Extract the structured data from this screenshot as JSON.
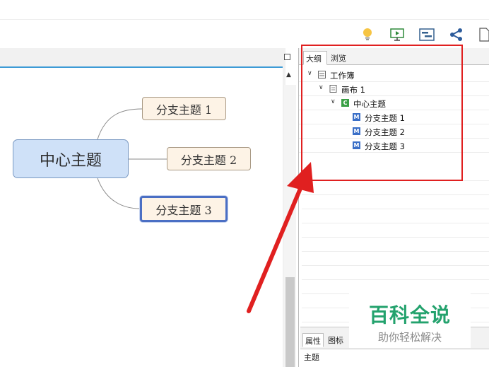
{
  "mindmap": {
    "central": "中心主题",
    "branches": [
      "分支主题 1",
      "分支主题 2",
      "分支主题 3"
    ]
  },
  "outline": {
    "tabs": [
      "大纲",
      "浏览"
    ],
    "tree": {
      "workbook": "工作簿",
      "sheet": "画布 1",
      "central": "中心主题",
      "central_icon_letter": "C",
      "branch_icon_letter": "M",
      "branches": [
        "分支主题 1",
        "分支主题 2",
        "分支主题 3"
      ]
    }
  },
  "bottom_panel": {
    "tabs": [
      "属性",
      "图标"
    ],
    "property_label": "主题"
  },
  "watermark": {
    "title": "百科全说",
    "subtitle": "助你轻松解决"
  },
  "toolbar": {
    "icons": [
      "lightbulb-icon",
      "presentation-icon",
      "gantt-icon",
      "share-icon",
      "export-icon"
    ]
  },
  "colors": {
    "central_fill": "#cfe1f8",
    "branch_fill": "#fdf3e6",
    "selection_border": "#4b6fc4",
    "annotation_red": "#e02020",
    "watermark_green": "#23a26d"
  }
}
